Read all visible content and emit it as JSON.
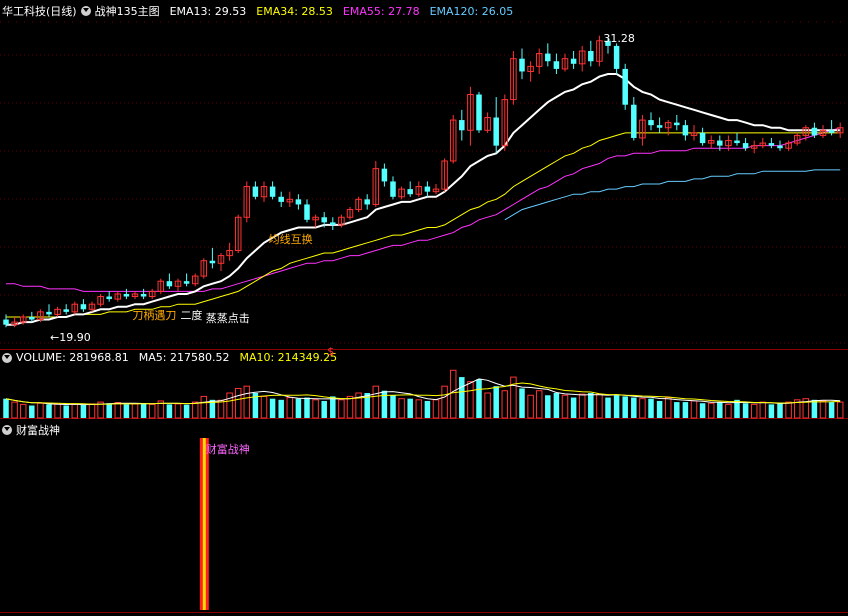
{
  "main_panel": {
    "stock_name": "华工科技(日线)",
    "template_name": "战神135主图",
    "indicators": [
      {
        "label": "EMA13: 29.53",
        "color": "#ffffff"
      },
      {
        "label": "EMA34: 28.53",
        "color": "#ffff00"
      },
      {
        "label": "EMA55: 27.78",
        "color": "#ff33ff"
      },
      {
        "label": "EMA120: 26.05",
        "color": "#66ccff"
      }
    ],
    "annotations": {
      "high_label": "31.28",
      "low_label": "←19.90",
      "signal_1": "均线互换",
      "signal_2": "刀柄遇刀",
      "signal_3": "二度",
      "signal_4": "蒸蒸点击",
      "dollar_marker": "$"
    }
  },
  "volume_panel": {
    "indicators": [
      {
        "label": "VOLUME: 281968.81",
        "color": "#ffffff"
      },
      {
        "label": "MA5: 217580.52",
        "color": "#ffffff"
      },
      {
        "label": "MA10: 214349.25",
        "color": "#ffff00"
      }
    ]
  },
  "wealth_panel": {
    "title": "财富战神",
    "bar_label": "财富战神"
  },
  "colors": {
    "up": "#ff3333",
    "down": "#54ffff",
    "ema13": "#ffffff",
    "ema34": "#ffff00",
    "ema55": "#ff33ff",
    "ema120": "#66ccff",
    "grid": "#8b0000"
  },
  "chart_data": {
    "type": "candlestick",
    "ohlc": [
      [
        20.2,
        20.4,
        19.9,
        20.0
      ],
      [
        20.0,
        20.3,
        19.9,
        20.1
      ],
      [
        20.1,
        20.4,
        20.0,
        20.3
      ],
      [
        20.3,
        20.5,
        20.1,
        20.2
      ],
      [
        20.2,
        20.6,
        20.1,
        20.5
      ],
      [
        20.5,
        20.8,
        20.3,
        20.4
      ],
      [
        20.4,
        20.7,
        20.3,
        20.6
      ],
      [
        20.6,
        20.8,
        20.4,
        20.5
      ],
      [
        20.5,
        20.9,
        20.4,
        20.8
      ],
      [
        20.8,
        21.0,
        20.5,
        20.6
      ],
      [
        20.6,
        20.9,
        20.5,
        20.8
      ],
      [
        20.8,
        21.2,
        20.7,
        21.1
      ],
      [
        21.1,
        21.3,
        20.9,
        21.0
      ],
      [
        21.0,
        21.3,
        20.9,
        21.2
      ],
      [
        21.2,
        21.4,
        21.0,
        21.1
      ],
      [
        21.1,
        21.3,
        21.0,
        21.2
      ],
      [
        21.2,
        21.4,
        21.0,
        21.1
      ],
      [
        21.1,
        21.4,
        21.0,
        21.3
      ],
      [
        21.3,
        21.8,
        21.2,
        21.7
      ],
      [
        21.7,
        22.0,
        21.4,
        21.5
      ],
      [
        21.5,
        21.8,
        21.3,
        21.7
      ],
      [
        21.7,
        22.0,
        21.5,
        21.6
      ],
      [
        21.6,
        22.0,
        21.5,
        21.9
      ],
      [
        21.9,
        22.6,
        21.8,
        22.5
      ],
      [
        22.5,
        23.0,
        22.2,
        22.4
      ],
      [
        22.4,
        22.8,
        22.1,
        22.7
      ],
      [
        22.7,
        23.2,
        22.5,
        22.9
      ],
      [
        22.9,
        24.3,
        22.8,
        24.2
      ],
      [
        24.2,
        25.6,
        24.0,
        25.4
      ],
      [
        25.4,
        25.6,
        24.9,
        25.0
      ],
      [
        25.0,
        25.6,
        24.8,
        25.4
      ],
      [
        25.4,
        25.6,
        24.9,
        25.0
      ],
      [
        25.0,
        25.2,
        24.6,
        24.8
      ],
      [
        24.8,
        25.2,
        24.6,
        24.9
      ],
      [
        24.9,
        25.1,
        24.5,
        24.7
      ],
      [
        24.7,
        24.9,
        24.0,
        24.1
      ],
      [
        24.1,
        24.3,
        23.8,
        24.2
      ],
      [
        24.2,
        24.4,
        23.8,
        24.0
      ],
      [
        24.0,
        24.2,
        23.7,
        23.9
      ],
      [
        23.9,
        24.3,
        23.8,
        24.2
      ],
      [
        24.2,
        24.6,
        24.1,
        24.5
      ],
      [
        24.5,
        25.0,
        24.4,
        24.9
      ],
      [
        24.9,
        25.1,
        24.5,
        24.7
      ],
      [
        24.7,
        26.4,
        24.6,
        26.1
      ],
      [
        26.1,
        26.3,
        25.4,
        25.6
      ],
      [
        25.6,
        25.8,
        24.9,
        25.0
      ],
      [
        25.0,
        25.4,
        24.9,
        25.3
      ],
      [
        25.3,
        25.6,
        25.0,
        25.1
      ],
      [
        25.1,
        25.6,
        25.0,
        25.4
      ],
      [
        25.4,
        25.6,
        25.0,
        25.2
      ],
      [
        25.2,
        25.5,
        25.1,
        25.3
      ],
      [
        25.3,
        26.5,
        25.2,
        26.4
      ],
      [
        26.4,
        28.2,
        26.3,
        28.0
      ],
      [
        28.0,
        28.4,
        27.2,
        27.6
      ],
      [
        27.6,
        29.3,
        27.0,
        29.0
      ],
      [
        29.0,
        29.1,
        27.5,
        27.6
      ],
      [
        27.6,
        28.3,
        27.5,
        28.1
      ],
      [
        28.1,
        28.9,
        26.7,
        27.0
      ],
      [
        27.0,
        29.0,
        26.8,
        28.8
      ],
      [
        28.8,
        30.7,
        28.6,
        30.4
      ],
      [
        30.4,
        30.8,
        29.6,
        29.9
      ],
      [
        29.9,
        30.3,
        29.5,
        30.1
      ],
      [
        30.1,
        30.8,
        29.8,
        30.6
      ],
      [
        30.6,
        31.0,
        30.1,
        30.3
      ],
      [
        30.3,
        30.6,
        29.8,
        30.0
      ],
      [
        30.0,
        30.6,
        29.9,
        30.4
      ],
      [
        30.4,
        30.7,
        30.0,
        30.2
      ],
      [
        30.2,
        30.9,
        29.9,
        30.7
      ],
      [
        30.7,
        31.1,
        30.1,
        30.3
      ],
      [
        30.3,
        31.3,
        30.1,
        31.1
      ],
      [
        31.1,
        31.2,
        30.6,
        30.9
      ],
      [
        30.9,
        31.0,
        29.8,
        30.0
      ],
      [
        30.0,
        30.2,
        28.4,
        28.6
      ],
      [
        28.6,
        28.9,
        27.2,
        27.3
      ],
      [
        27.3,
        28.2,
        27.0,
        28.0
      ],
      [
        28.0,
        28.3,
        27.6,
        27.8
      ],
      [
        27.8,
        28.1,
        27.5,
        27.7
      ],
      [
        27.7,
        28.0,
        27.4,
        27.9
      ],
      [
        27.9,
        28.2,
        27.6,
        27.8
      ],
      [
        27.8,
        28.0,
        27.2,
        27.4
      ],
      [
        27.4,
        27.8,
        27.2,
        27.5
      ],
      [
        27.5,
        27.7,
        27.0,
        27.1
      ],
      [
        27.1,
        27.4,
        26.9,
        27.2
      ],
      [
        27.2,
        27.4,
        26.8,
        27.0
      ],
      [
        27.0,
        27.4,
        26.8,
        27.2
      ],
      [
        27.2,
        27.5,
        27.0,
        27.1
      ],
      [
        27.1,
        27.3,
        26.8,
        26.9
      ],
      [
        26.9,
        27.2,
        26.7,
        27.0
      ],
      [
        27.0,
        27.3,
        26.9,
        27.1
      ],
      [
        27.1,
        27.3,
        26.9,
        27.0
      ],
      [
        27.0,
        27.2,
        26.8,
        26.9
      ],
      [
        26.9,
        27.2,
        26.8,
        27.1
      ],
      [
        27.1,
        27.5,
        27.0,
        27.4
      ],
      [
        27.4,
        27.8,
        27.2,
        27.7
      ],
      [
        27.7,
        27.9,
        27.3,
        27.4
      ],
      [
        27.4,
        27.8,
        27.3,
        27.6
      ],
      [
        27.6,
        28.0,
        27.4,
        27.5
      ],
      [
        27.5,
        27.9,
        27.3,
        27.7
      ]
    ],
    "ema13": [
      20.0,
      20.0,
      20.1,
      20.1,
      20.2,
      20.2,
      20.3,
      20.3,
      20.4,
      20.4,
      20.5,
      20.6,
      20.6,
      20.7,
      20.7,
      20.8,
      20.8,
      20.9,
      21.0,
      21.1,
      21.2,
      21.2,
      21.3,
      21.5,
      21.6,
      21.7,
      21.9,
      22.2,
      22.6,
      22.9,
      23.2,
      23.4,
      23.6,
      23.7,
      23.8,
      23.8,
      23.8,
      23.9,
      23.9,
      23.9,
      24.0,
      24.1,
      24.2,
      24.5,
      24.6,
      24.7,
      24.8,
      24.8,
      24.9,
      25.0,
      25.0,
      25.2,
      25.5,
      25.8,
      26.2,
      26.4,
      26.6,
      26.7,
      27.0,
      27.5,
      27.8,
      28.1,
      28.4,
      28.7,
      28.9,
      29.1,
      29.2,
      29.4,
      29.5,
      29.7,
      29.8,
      29.8,
      29.6,
      29.3,
      29.1,
      29.0,
      28.8,
      28.7,
      28.6,
      28.5,
      28.4,
      28.3,
      28.2,
      28.1,
      28.0,
      28.0,
      27.9,
      27.8,
      27.8,
      27.7,
      27.7,
      27.6,
      27.6,
      27.6,
      27.6,
      27.6,
      27.6,
      27.6
    ],
    "ema34": [
      20.3,
      20.3,
      20.3,
      20.3,
      20.3,
      20.3,
      20.3,
      20.3,
      20.4,
      20.4,
      20.4,
      20.4,
      20.5,
      20.5,
      20.5,
      20.6,
      20.6,
      20.6,
      20.7,
      20.7,
      20.8,
      20.8,
      20.8,
      20.9,
      21.0,
      21.1,
      21.2,
      21.3,
      21.5,
      21.7,
      21.9,
      22.1,
      22.2,
      22.4,
      22.5,
      22.6,
      22.7,
      22.8,
      22.8,
      22.9,
      23.0,
      23.1,
      23.2,
      23.3,
      23.4,
      23.5,
      23.5,
      23.6,
      23.7,
      23.8,
      23.8,
      23.9,
      24.1,
      24.3,
      24.5,
      24.6,
      24.8,
      24.9,
      25.1,
      25.4,
      25.6,
      25.8,
      26.0,
      26.2,
      26.4,
      26.6,
      26.7,
      26.9,
      27.0,
      27.2,
      27.3,
      27.4,
      27.5,
      27.5,
      27.5,
      27.5,
      27.5,
      27.5,
      27.5,
      27.5,
      27.5,
      27.5,
      27.5,
      27.5,
      27.5,
      27.5,
      27.5,
      27.5,
      27.5,
      27.5,
      27.5,
      27.5,
      27.5,
      27.5,
      27.5,
      27.5,
      27.5,
      27.5
    ],
    "ema55": [
      21.6,
      21.6,
      21.5,
      21.5,
      21.5,
      21.4,
      21.4,
      21.4,
      21.4,
      21.3,
      21.3,
      21.3,
      21.3,
      21.3,
      21.3,
      21.3,
      21.3,
      21.3,
      21.3,
      21.3,
      21.3,
      21.3,
      21.3,
      21.3,
      21.4,
      21.4,
      21.5,
      21.6,
      21.7,
      21.8,
      21.9,
      22.0,
      22.1,
      22.2,
      22.3,
      22.4,
      22.4,
      22.5,
      22.5,
      22.6,
      22.7,
      22.7,
      22.8,
      22.9,
      23.0,
      23.1,
      23.1,
      23.2,
      23.3,
      23.3,
      23.4,
      23.5,
      23.6,
      23.8,
      23.9,
      24.1,
      24.2,
      24.3,
      24.5,
      24.7,
      24.9,
      25.1,
      25.3,
      25.4,
      25.6,
      25.8,
      25.9,
      26.1,
      26.2,
      26.3,
      26.5,
      26.6,
      26.6,
      26.7,
      26.7,
      26.7,
      26.8,
      26.8,
      26.8,
      26.8,
      26.9,
      26.9,
      26.9,
      26.9,
      26.9,
      26.9,
      26.9,
      27.0,
      27.0,
      27.0,
      27.0,
      27.1,
      27.2,
      27.3,
      27.4,
      27.5,
      27.6,
      27.7
    ],
    "ema120": [
      null,
      null,
      null,
      null,
      null,
      null,
      null,
      null,
      null,
      null,
      null,
      null,
      null,
      null,
      null,
      null,
      null,
      null,
      null,
      null,
      null,
      null,
      null,
      null,
      null,
      null,
      null,
      null,
      null,
      null,
      null,
      null,
      null,
      null,
      null,
      null,
      null,
      null,
      null,
      null,
      null,
      null,
      null,
      null,
      null,
      null,
      null,
      null,
      null,
      null,
      null,
      null,
      null,
      null,
      null,
      null,
      null,
      null,
      24.1,
      24.3,
      24.5,
      24.6,
      24.7,
      24.8,
      24.9,
      25.0,
      25.1,
      25.1,
      25.2,
      25.2,
      25.3,
      25.3,
      25.4,
      25.4,
      25.5,
      25.5,
      25.5,
      25.6,
      25.6,
      25.6,
      25.7,
      25.7,
      25.8,
      25.8,
      25.8,
      25.9,
      25.9,
      25.9,
      26.0,
      26.0,
      26.0,
      26.0,
      26.0,
      26.0,
      26.05,
      26.05,
      26.05,
      26.05
    ],
    "volume": [
      0.85,
      0.7,
      0.6,
      0.55,
      0.65,
      0.6,
      0.62,
      0.55,
      0.6,
      0.58,
      0.62,
      0.7,
      0.65,
      0.68,
      0.6,
      0.62,
      0.65,
      0.6,
      0.75,
      0.6,
      0.62,
      0.58,
      0.7,
      0.95,
      0.8,
      0.78,
      1.1,
      1.3,
      1.4,
      1.1,
      0.95,
      0.85,
      0.8,
      0.9,
      0.85,
      0.9,
      0.8,
      0.75,
      0.95,
      0.8,
      0.95,
      1.1,
      1.1,
      1.4,
      1.2,
      1.0,
      0.85,
      0.85,
      0.8,
      0.75,
      0.8,
      1.4,
      2.1,
      1.8,
      1.6,
      1.7,
      1.1,
      1.4,
      1.2,
      1.8,
      1.3,
      1.0,
      1.2,
      1.0,
      1.1,
      1.0,
      0.9,
      1.05,
      1.1,
      1.05,
      0.9,
      1.0,
      0.95,
      0.9,
      0.85,
      0.85,
      0.75,
      0.9,
      0.7,
      0.7,
      0.75,
      0.65,
      0.65,
      0.7,
      0.6,
      0.8,
      0.65,
      0.6,
      0.7,
      0.6,
      0.65,
      0.7,
      0.8,
      0.85,
      0.8,
      0.75,
      0.7,
      0.7
    ],
    "signal_index": 23,
    "high_index": 69,
    "low_index": 0
  }
}
